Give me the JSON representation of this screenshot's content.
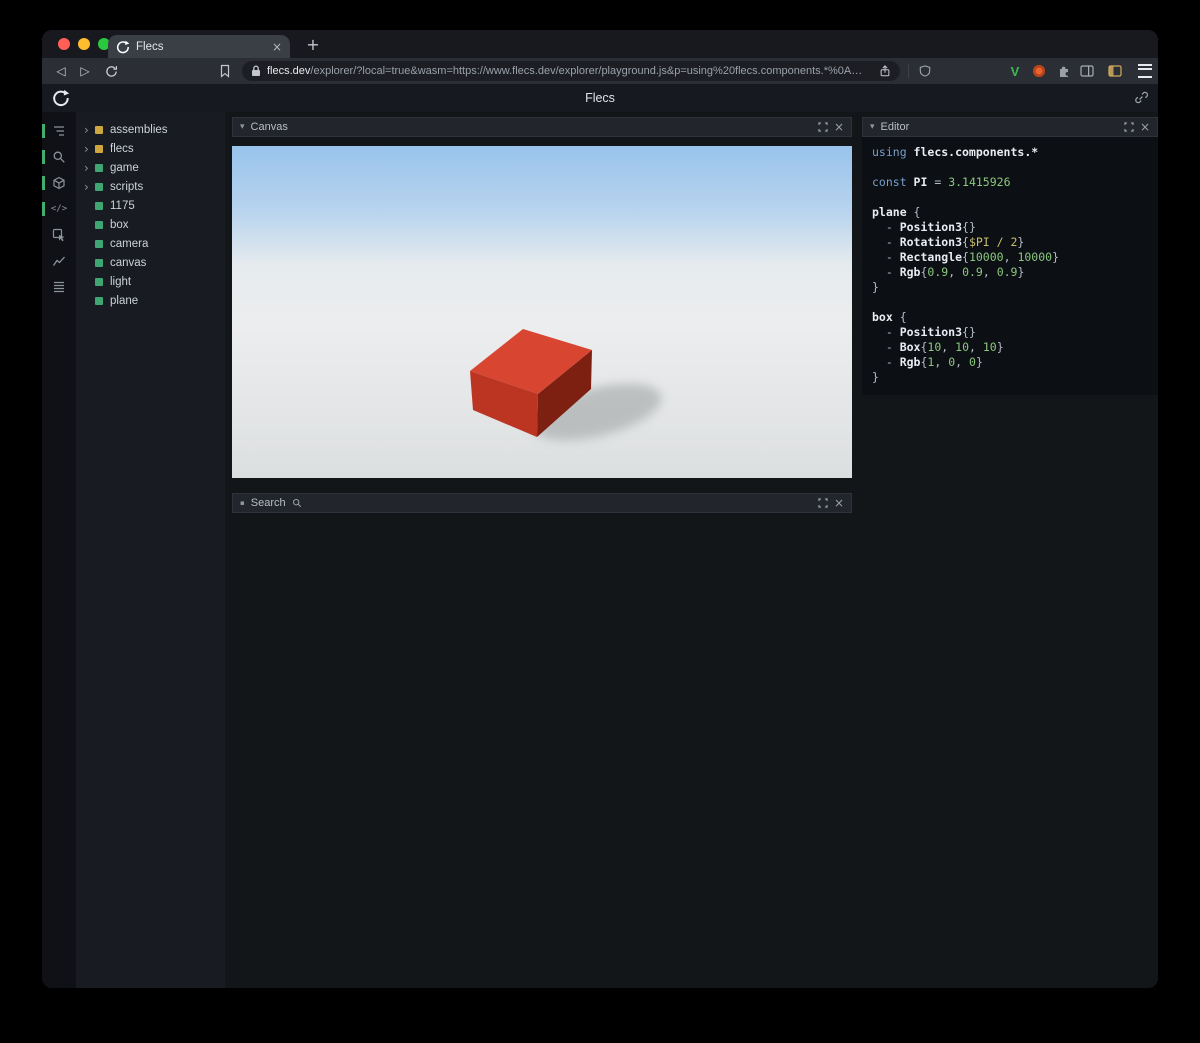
{
  "browser": {
    "tab_title": "Flecs",
    "url_host": "flecs.dev",
    "url_rest": "/explorer/?local=true&wasm=https://www.flecs.dev/explorer/playground.js&p=using%20flecs.components.*%0A…",
    "vimium_label": "V"
  },
  "app": {
    "title": "Flecs"
  },
  "icons": {
    "chevron_down": "▾",
    "tree_expand": "›",
    "close": "×",
    "new_tab": "+",
    "back": "◁",
    "forward": "▷",
    "bullet": "▪",
    "code_glyph": "</>"
  },
  "tree": {
    "items": [
      {
        "label": "assemblies",
        "color": "#cfa73f",
        "has_children": true
      },
      {
        "label": "flecs",
        "color": "#cfa73f",
        "has_children": true
      },
      {
        "label": "game",
        "color": "#3fa573",
        "has_children": true
      },
      {
        "label": "scripts",
        "color": "#3fa573",
        "has_children": true
      },
      {
        "label": "1175",
        "color": "#3fa573",
        "has_children": false
      },
      {
        "label": "box",
        "color": "#3fa573",
        "has_children": false
      },
      {
        "label": "camera",
        "color": "#3fa573",
        "has_children": false
      },
      {
        "label": "canvas",
        "color": "#3fa573",
        "has_children": false
      },
      {
        "label": "light",
        "color": "#3fa573",
        "has_children": false
      },
      {
        "label": "plane",
        "color": "#3fa573",
        "has_children": false
      }
    ]
  },
  "panels": {
    "canvas": {
      "title": "Canvas"
    },
    "search": {
      "title": "Search"
    },
    "editor": {
      "title": "Editor"
    }
  },
  "code": {
    "lines": [
      [
        [
          "kw",
          "using "
        ],
        [
          "idb",
          "flecs.components.*"
        ]
      ],
      [],
      [
        [
          "kw",
          "const "
        ],
        [
          "idb",
          "PI"
        ],
        [
          "pl",
          " = "
        ],
        [
          "num",
          "3.1415926"
        ]
      ],
      [],
      [
        [
          "idb",
          "plane"
        ],
        [
          "pl",
          " {"
        ]
      ],
      [
        [
          "pl",
          "  - "
        ],
        [
          "idb",
          "Position3"
        ],
        [
          "pl",
          "{}"
        ]
      ],
      [
        [
          "pl",
          "  - "
        ],
        [
          "idb",
          "Rotation3"
        ],
        [
          "pl",
          "{"
        ],
        [
          "var",
          "$PI / 2"
        ],
        [
          "pl",
          "}"
        ]
      ],
      [
        [
          "pl",
          "  - "
        ],
        [
          "idb",
          "Rectangle"
        ],
        [
          "pl",
          "{"
        ],
        [
          "num",
          "10000"
        ],
        [
          "pl",
          ", "
        ],
        [
          "num",
          "10000"
        ],
        [
          "pl",
          "}"
        ]
      ],
      [
        [
          "pl",
          "  - "
        ],
        [
          "idb",
          "Rgb"
        ],
        [
          "pl",
          "{"
        ],
        [
          "num",
          "0.9"
        ],
        [
          "pl",
          ", "
        ],
        [
          "num",
          "0.9"
        ],
        [
          "pl",
          ", "
        ],
        [
          "num",
          "0.9"
        ],
        [
          "pl",
          "}"
        ]
      ],
      [
        [
          "pl",
          "}"
        ]
      ],
      [],
      [
        [
          "idb",
          "box"
        ],
        [
          "pl",
          " {"
        ]
      ],
      [
        [
          "pl",
          "  - "
        ],
        [
          "idb",
          "Position3"
        ],
        [
          "pl",
          "{}"
        ]
      ],
      [
        [
          "pl",
          "  - "
        ],
        [
          "idb",
          "Box"
        ],
        [
          "pl",
          "{"
        ],
        [
          "num",
          "10"
        ],
        [
          "pl",
          ", "
        ],
        [
          "num",
          "10"
        ],
        [
          "pl",
          ", "
        ],
        [
          "num",
          "10"
        ],
        [
          "pl",
          "}"
        ]
      ],
      [
        [
          "pl",
          "  - "
        ],
        [
          "idb",
          "Rgb"
        ],
        [
          "pl",
          "{"
        ],
        [
          "num",
          "1"
        ],
        [
          "pl",
          ", "
        ],
        [
          "num",
          "0"
        ],
        [
          "pl",
          ", "
        ],
        [
          "num",
          "0"
        ],
        [
          "pl",
          "}"
        ]
      ],
      [
        [
          "pl",
          "}"
        ]
      ]
    ]
  },
  "scene": {
    "sky_top": "#98c3eb",
    "sky_mid": "#b9d4ee",
    "horizon": "#e6ebee",
    "ground_far": "#ecedee",
    "ground_near": "#dcdfe0",
    "shadow": "#aeb2b3",
    "box_top": "#d84531",
    "box_left": "#bb3522",
    "box_right": "#7d2011"
  }
}
